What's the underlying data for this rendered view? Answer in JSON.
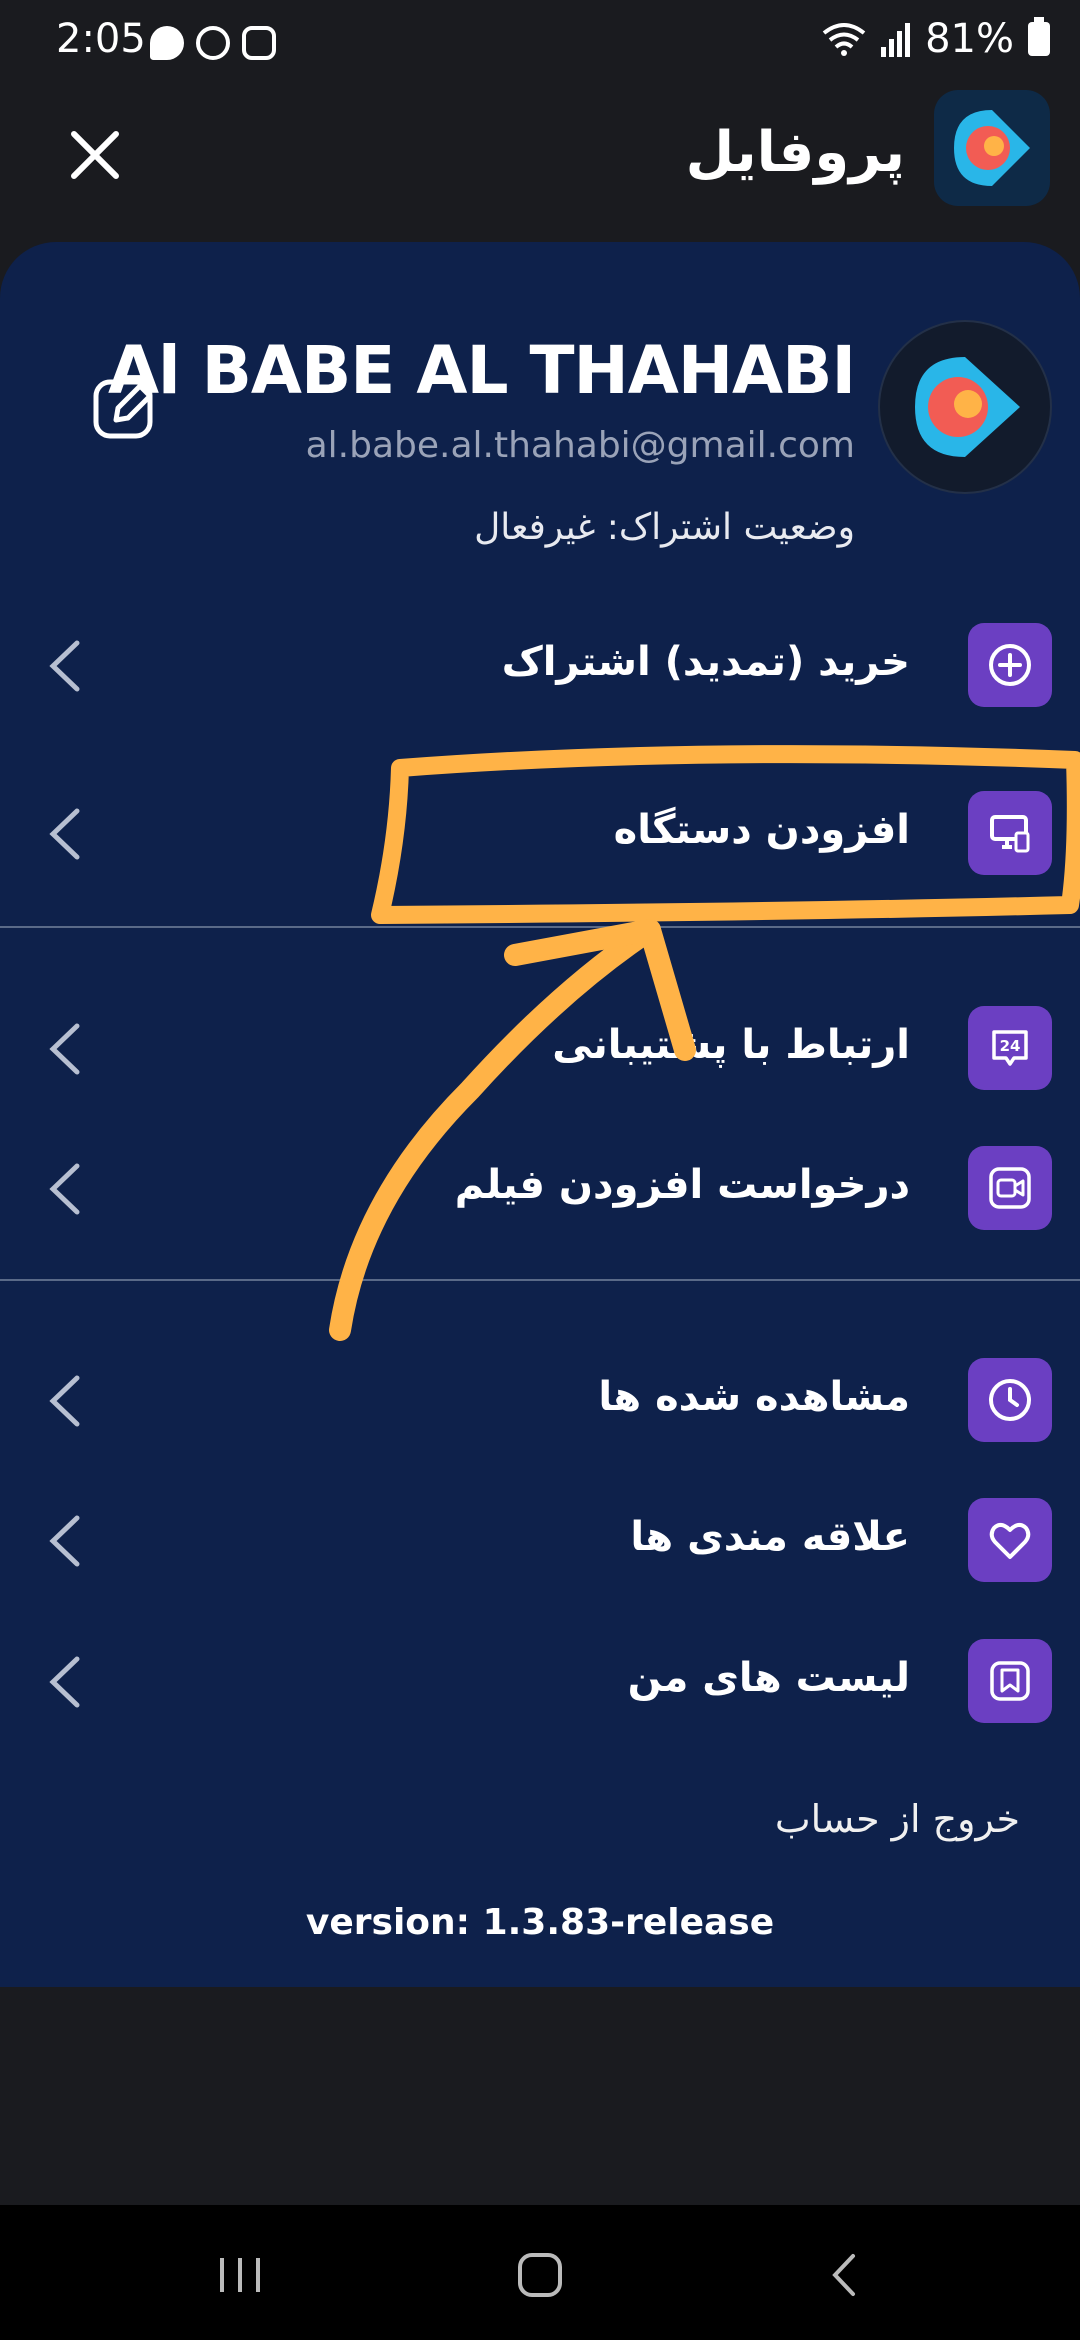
{
  "status_bar": {
    "time": "2:05",
    "battery": "81%"
  },
  "header": {
    "title": "پروفایل"
  },
  "profile": {
    "name": "Al BABE AL THAHABI",
    "email": "al.babe.al.thahabi@gmail.com",
    "subscription_status": "وضعیت اشتراک: غیرفعال"
  },
  "menu": [
    {
      "label": "خرید (تمدید) اشتراک",
      "icon": "plus-circle-icon"
    },
    {
      "label": "افزودن دستگاه",
      "icon": "devices-icon"
    },
    {
      "label": "ارتباط با پشتیبانی",
      "icon": "support-24-icon"
    },
    {
      "label": "درخواست افزودن فیلم",
      "icon": "video-camera-icon"
    },
    {
      "label": "مشاهده شده ها",
      "icon": "clock-icon"
    },
    {
      "label": "علاقه مندی ها",
      "icon": "heart-icon"
    },
    {
      "label": "لیست های من",
      "icon": "bookmark-icon"
    }
  ],
  "support_icon_text": "24",
  "logout_label": "خروج از حساب",
  "version_label": "version: 1.3.83-release",
  "colors": {
    "panel": "#0e214b",
    "icon_bg": "#6b3fc2",
    "annotation": "#ffb347"
  }
}
